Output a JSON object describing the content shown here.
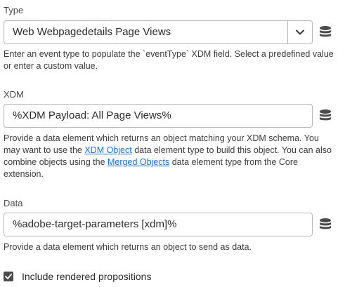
{
  "type_field": {
    "label": "Type",
    "value": "Web Webpagedetails Page Views",
    "help": "Enter an event type to populate the `eventType` XDM field. Select a predefined value or enter a custom value.",
    "toggle_icon": "chevron-down-icon",
    "data_element_icon": "database-icon"
  },
  "xdm_field": {
    "label": "XDM",
    "value": "%XDM Payload: All Page Views%",
    "help_part1": "Provide a data element which returns an object matching your XDM schema. You may want to use the ",
    "help_link1": "XDM Object",
    "help_part2": " data element type to build this object. You can also combine objects using the ",
    "help_link2": "Merged Objects",
    "help_part3": " data element type from the Core extension.",
    "data_element_icon": "database-icon"
  },
  "data_field": {
    "label": "Data",
    "value": "%adobe-target-parameters [xdm]%",
    "help": "Provide a data element which returns an object to send as data.",
    "data_element_icon": "database-icon"
  },
  "include_propositions": {
    "label": "Include rendered propositions",
    "checked": true
  },
  "colors": {
    "link": "#1473e6",
    "border": "#b6b6b6",
    "checkbox": "#4b4b4b"
  }
}
